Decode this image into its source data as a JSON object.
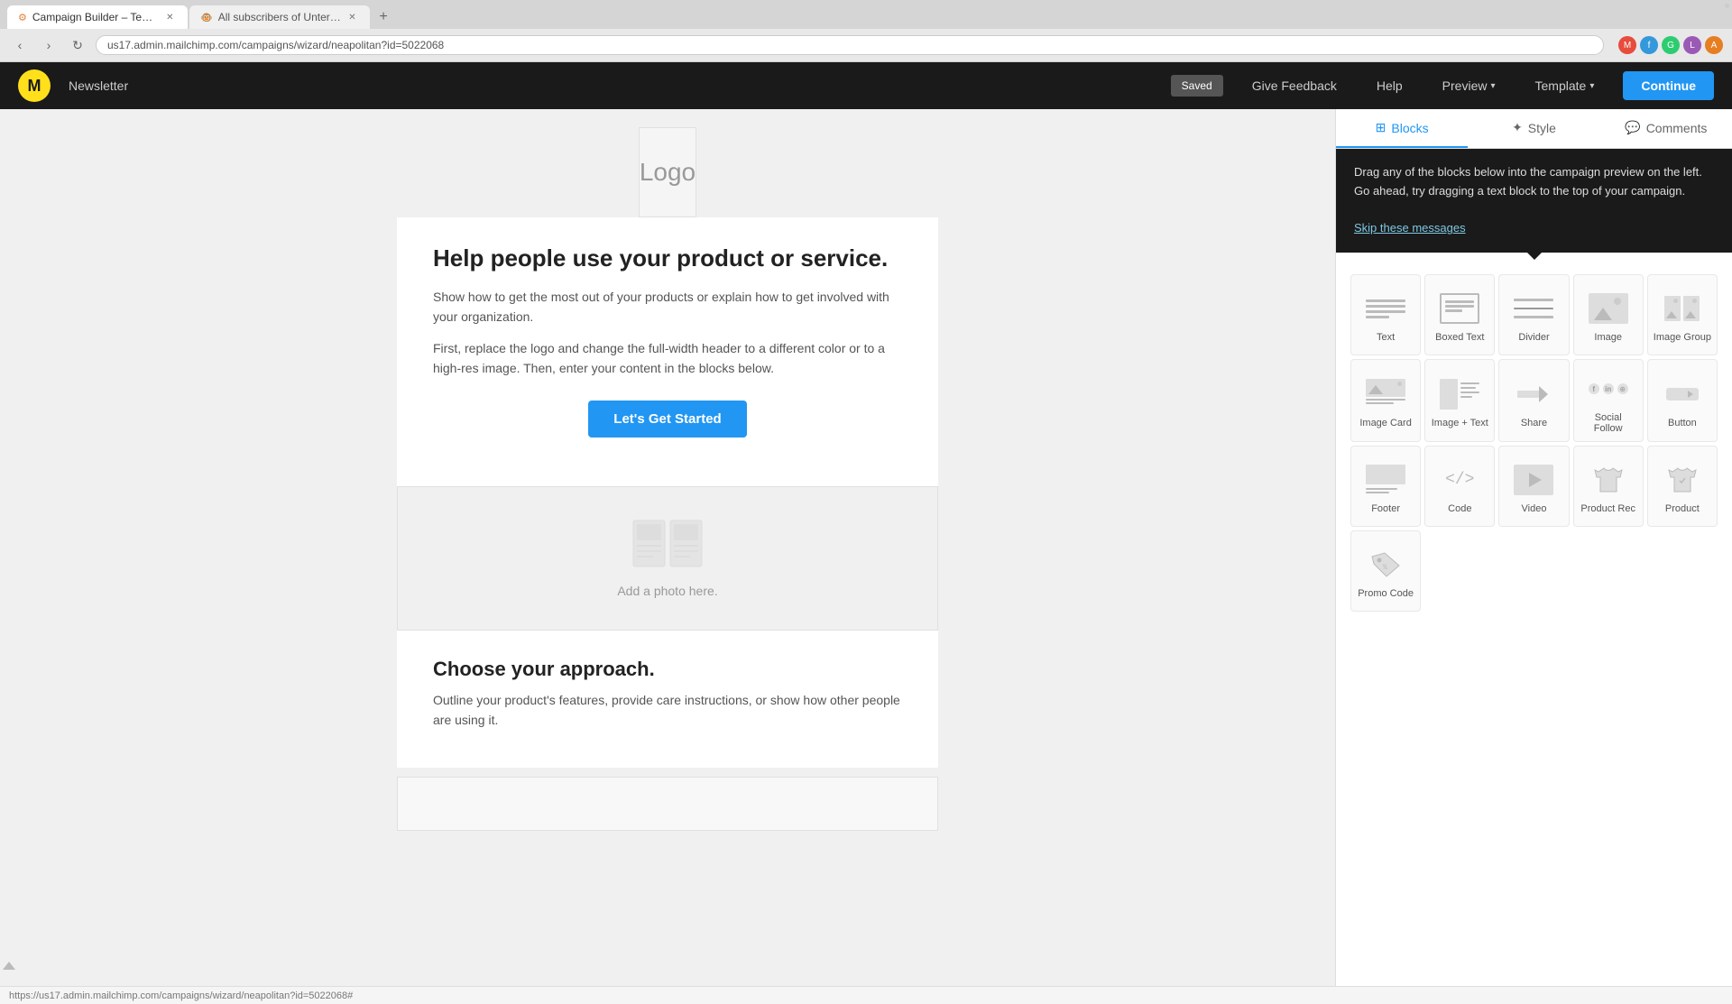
{
  "browser": {
    "tabs": [
      {
        "id": "tab1",
        "label": "Campaign Builder – Template …",
        "active": true
      },
      {
        "id": "tab2",
        "label": "All subscribers of Unternehmh…",
        "active": false
      }
    ],
    "new_tab_label": "+",
    "url": "us17.admin.mailchimp.com/campaigns/wizard/neapolitan?id=5022068",
    "nav": {
      "back": "‹",
      "forward": "›",
      "refresh": "↻"
    }
  },
  "header": {
    "logo_text": "M",
    "nav_item": "Newsletter",
    "saved_label": "Saved",
    "give_feedback_label": "Give Feedback",
    "help_label": "Help",
    "preview_label": "Preview",
    "template_label": "Template",
    "continue_label": "Continue"
  },
  "panel": {
    "tabs": [
      {
        "id": "blocks",
        "label": "Blocks",
        "active": true
      },
      {
        "id": "style",
        "label": "Style",
        "active": false
      },
      {
        "id": "comments",
        "label": "Comments",
        "active": false
      }
    ],
    "info_banner": {
      "text": "Drag any of the blocks below into the campaign preview on the left. Go ahead, try dragging a text block to the top of your campaign.",
      "skip_label": "Skip these messages"
    },
    "blocks": [
      {
        "id": "text",
        "label": "Text",
        "icon": "text-icon"
      },
      {
        "id": "boxed-text",
        "label": "Boxed Text",
        "icon": "boxed-text-icon"
      },
      {
        "id": "divider",
        "label": "Divider",
        "icon": "divider-icon"
      },
      {
        "id": "image",
        "label": "Image",
        "icon": "image-icon"
      },
      {
        "id": "image-group",
        "label": "Image Group",
        "icon": "image-group-icon"
      },
      {
        "id": "image-card",
        "label": "Image Card",
        "icon": "image-card-icon"
      },
      {
        "id": "image-text",
        "label": "Image + Text",
        "icon": "image-text-icon"
      },
      {
        "id": "share",
        "label": "Share",
        "icon": "share-icon"
      },
      {
        "id": "social-follow",
        "label": "Social Follow",
        "icon": "social-follow-icon"
      },
      {
        "id": "button",
        "label": "Button",
        "icon": "button-icon"
      },
      {
        "id": "footer",
        "label": "Footer",
        "icon": "footer-icon"
      },
      {
        "id": "code",
        "label": "Code",
        "icon": "code-icon"
      },
      {
        "id": "video",
        "label": "Video",
        "icon": "video-icon"
      },
      {
        "id": "product-rec",
        "label": "Product Rec",
        "icon": "product-rec-icon"
      },
      {
        "id": "product",
        "label": "Product",
        "icon": "product-icon"
      },
      {
        "id": "promo-code",
        "label": "Promo Code",
        "icon": "promo-code-icon"
      }
    ]
  },
  "email": {
    "logo_label": "Logo",
    "main_heading": "Help people use your product or service.",
    "body_text_1": "Show how to get the most out of your products or explain how to get involved with your organization.",
    "body_text_2": "First, replace the logo and change the full-width header to a different color or to a high-res image. Then, enter your content in the blocks below.",
    "cta_label": "Let's Get Started",
    "image_caption": "Add a photo here.",
    "section_heading": "Choose your approach.",
    "section_body": "Outline your product's features, provide care instructions, or show how other people are using it."
  },
  "status_bar": {
    "url": "https://us17.admin.mailchimp.com/campaigns/wizard/neapolitan?id=5022068#"
  },
  "colors": {
    "cta_blue": "#2196f3",
    "header_dark": "#1a1a1a",
    "logo_yellow": "#ffe01b",
    "active_tab_blue": "#2196f3"
  }
}
